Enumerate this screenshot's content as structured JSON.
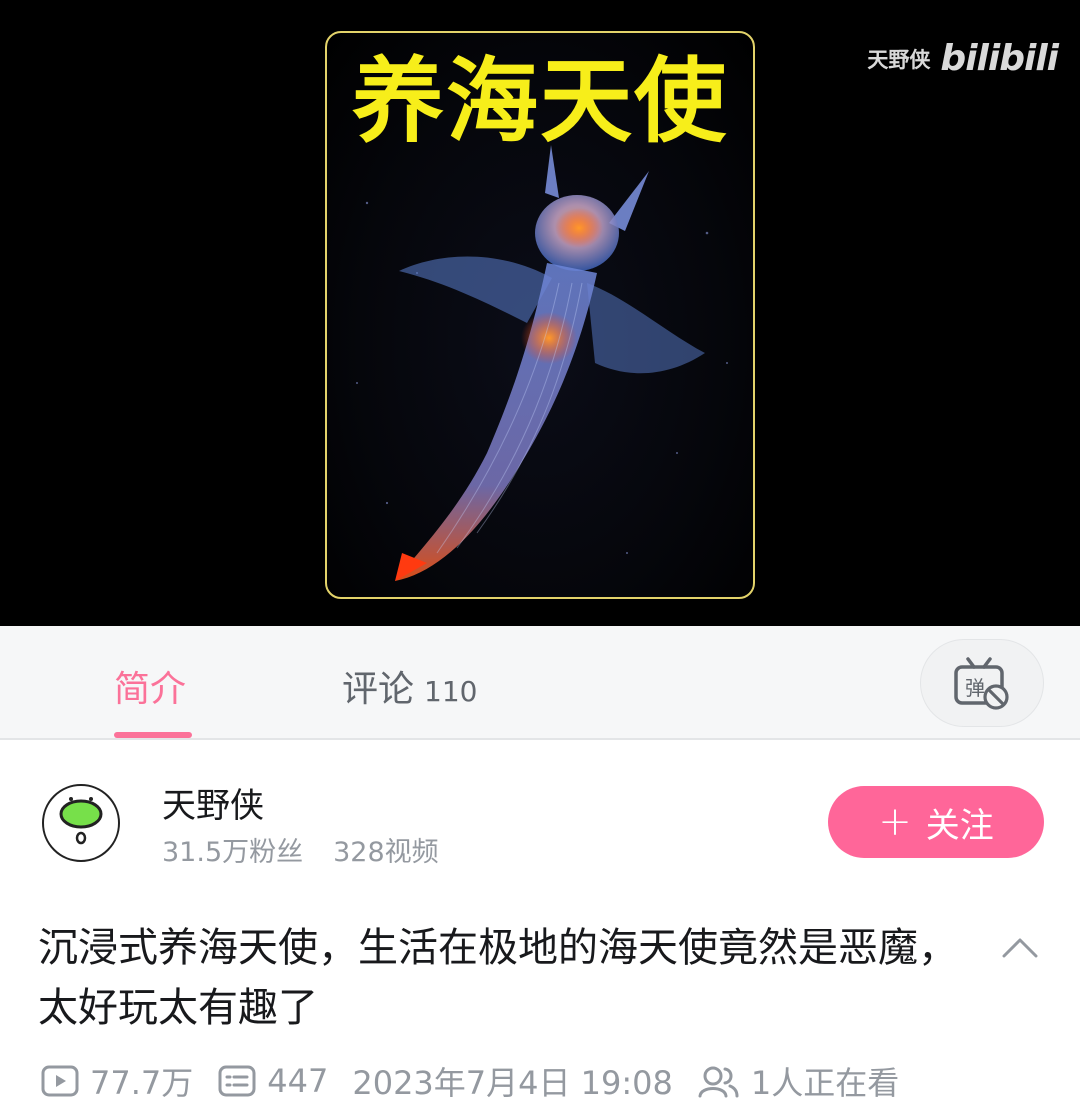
{
  "player": {
    "cover_title": "养海天使",
    "watermark_name": "天野侠",
    "watermark_logo": "bilibili"
  },
  "tabs": {
    "intro_label": "简介",
    "comments_label": "评论",
    "comments_count": "110",
    "danmaku_icon": "danmaku-off-icon"
  },
  "uploader": {
    "name": "天野侠",
    "fans": "31.5万粉丝",
    "videos": "328视频",
    "follow_plus": "+",
    "follow_label": "关注"
  },
  "video": {
    "title": "沉浸式养海天使，生活在极地的海天使竟然是恶魔，太好玩太有趣了",
    "views": "77.7万",
    "danmaku_count": "447",
    "publish_time": "2023年7月4日 19:08",
    "watching": "1人正在看"
  },
  "colors": {
    "accent": "#fb7299",
    "follow_button": "#ff6699",
    "cover_title": "#f7ee1a"
  }
}
